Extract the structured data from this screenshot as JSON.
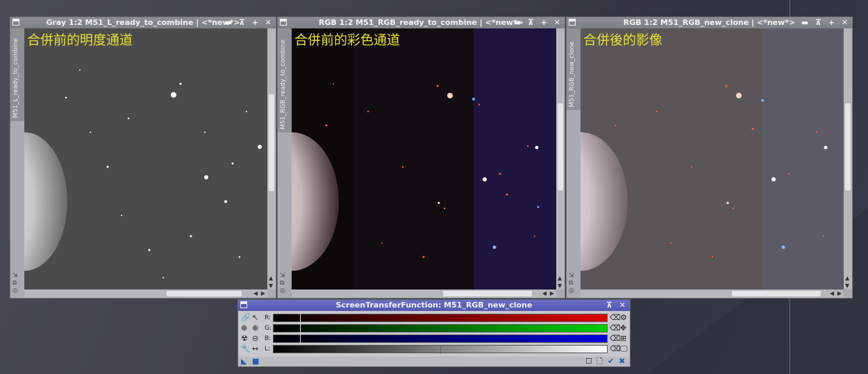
{
  "windows": [
    {
      "title": "Gray 1:2 M51_L_ready_to_combine | <*new*>",
      "tab": "M51_L_ready_to_combine",
      "caption": "合併前的明度通道"
    },
    {
      "title": "RGB 1:2 M51_RGB_ready_to_combine | <*new*>",
      "tab": "M51_RGB_ready_to_combine",
      "caption": "合併前的彩色通道"
    },
    {
      "title": "RGB 1:2 M51_RGB_new_clone | <*new*>",
      "tab": "M51_RGB_new_clone",
      "caption": "合併後的影像"
    }
  ],
  "title_buttons": "▬ ⊼ + ✕",
  "stf": {
    "title": "ScreenTransferFunction: M51_RGB_new_clone",
    "channels": [
      {
        "label": "R:",
        "color": "#e00000"
      },
      {
        "label": "G:",
        "color": "#00d000"
      },
      {
        "label": "B:",
        "color": "#0000e0"
      },
      {
        "label": "L:",
        "color": "#ffffff"
      }
    ]
  }
}
